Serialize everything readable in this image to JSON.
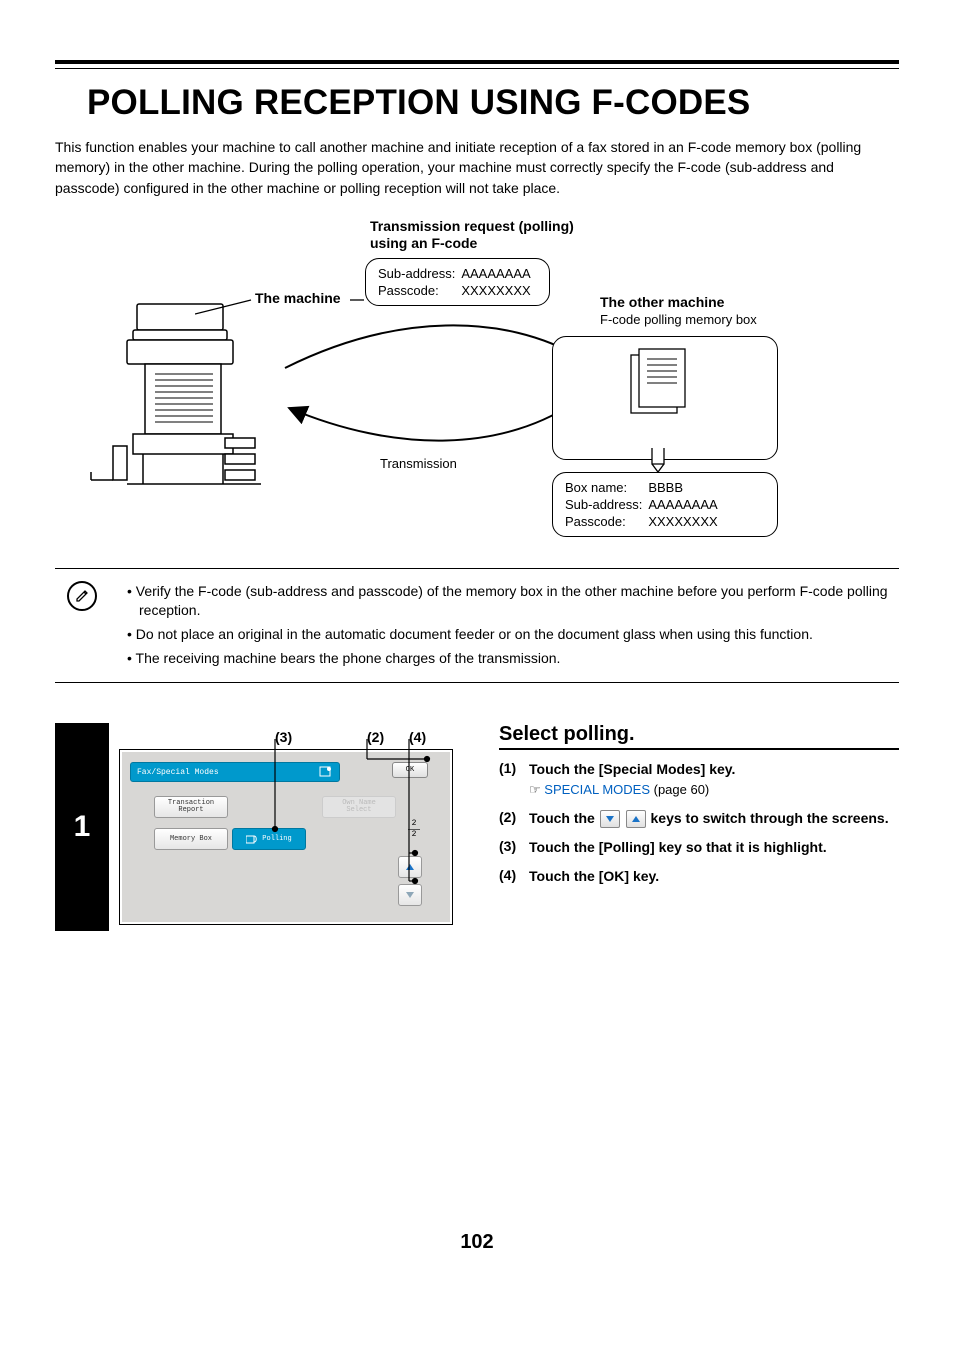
{
  "page_number": "102",
  "title": "POLLING RECEPTION USING F-CODES",
  "intro": "This function enables your machine to call another machine and initiate reception of a fax stored in an F-code memory box (polling memory) in the other machine. During the polling operation, your machine must correctly specify the F-code (sub-address and passcode) configured in the other machine or polling reception will not take place.",
  "diagram": {
    "req_heading_line1": "Transmission request (polling)",
    "req_heading_line2": "using an F-code",
    "machine_label": "The machine",
    "other_label": "The other machine",
    "other_sub": "F-code polling memory box",
    "transmission_label": "Transmission",
    "req_box": {
      "sub_address_label": "Sub-address:",
      "sub_address_value": "AAAAAAAA",
      "passcode_label": "Passcode:",
      "passcode_value": "XXXXXXXX"
    },
    "mem_box": {
      "box_name_label": "Box name:",
      "box_name_value": "BBBB",
      "sub_address_label": "Sub-address:",
      "sub_address_value": "AAAAAAAA",
      "passcode_label": "Passcode:",
      "passcode_value": "XXXXXXXX"
    }
  },
  "notes": {
    "items": [
      "Verify the F-code (sub-address and passcode) of the memory box in the other machine before you perform F-code polling reception.",
      "Do not place an original in the automatic document feeder or on the document glass when using this function.",
      "The receiving machine bears the phone charges of the transmission."
    ]
  },
  "step1": {
    "number": "1",
    "callouts": {
      "c2": "(2)",
      "c3": "(3)",
      "c4": "(4)"
    },
    "screen": {
      "title": "Fax/Special Modes",
      "ok": "OK",
      "transaction_report": "Transaction\nReport",
      "own_name_select": "Own Name\nSelect",
      "memory_box": "Memory Box",
      "polling": "Polling",
      "page_num": "2",
      "page_den": "2"
    },
    "heading": "Select polling.",
    "substeps": [
      {
        "num": "(1)",
        "text": "Touch the [Special Modes] key.",
        "ref_link": "SPECIAL MODES",
        "ref_suffix": " (page 60)"
      },
      {
        "num": "(2)",
        "text_before": "Touch the ",
        "text_after": " keys to switch through the screens."
      },
      {
        "num": "(3)",
        "text": "Touch the [Polling] key so that it is highlight."
      },
      {
        "num": "(4)",
        "text": "Touch the [OK] key."
      }
    ]
  }
}
